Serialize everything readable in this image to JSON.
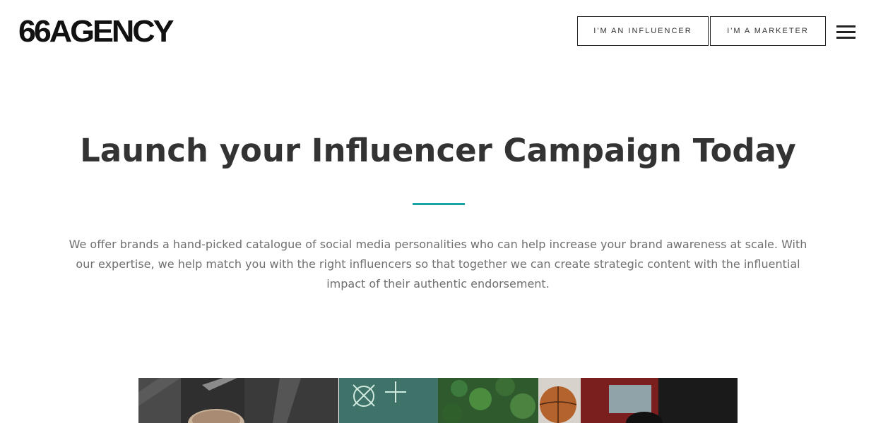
{
  "header": {
    "logo_text": "66AGENCY",
    "influencer_button": "I'M AN INFLUENCER",
    "marketer_button": "I'M A MARKETER",
    "menu_icon": "hamburger-menu-icon"
  },
  "hero": {
    "title": "Launch your Influencer Campaign Today",
    "divider_color": "#1aa3a3",
    "description": "We offer brands a hand-picked catalogue of social media personalities who can help increase your brand awareness at scale. With our expertise, we help match you with the right influencers so that together we can create strategic content with the influential impact of their authentic endorsement."
  },
  "photos": [
    {
      "name": "influencer-photo-1"
    },
    {
      "name": "influencer-photo-2"
    },
    {
      "name": "influencer-photo-3"
    }
  ]
}
